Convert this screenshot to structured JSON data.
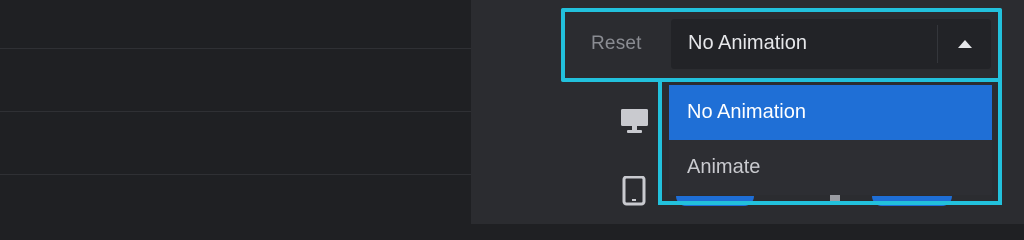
{
  "animation_control": {
    "reset_label": "Reset",
    "selected_value": "No Animation",
    "options": [
      "No Animation",
      "Animate"
    ],
    "selected_index": 0
  },
  "devices": [
    "desktop-icon",
    "tablet-icon"
  ],
  "colors": {
    "highlight": "#22c1dc",
    "selected_option": "#1f6fd6",
    "panel_bg": "#2b2c30",
    "left_bg": "#1f2023"
  }
}
